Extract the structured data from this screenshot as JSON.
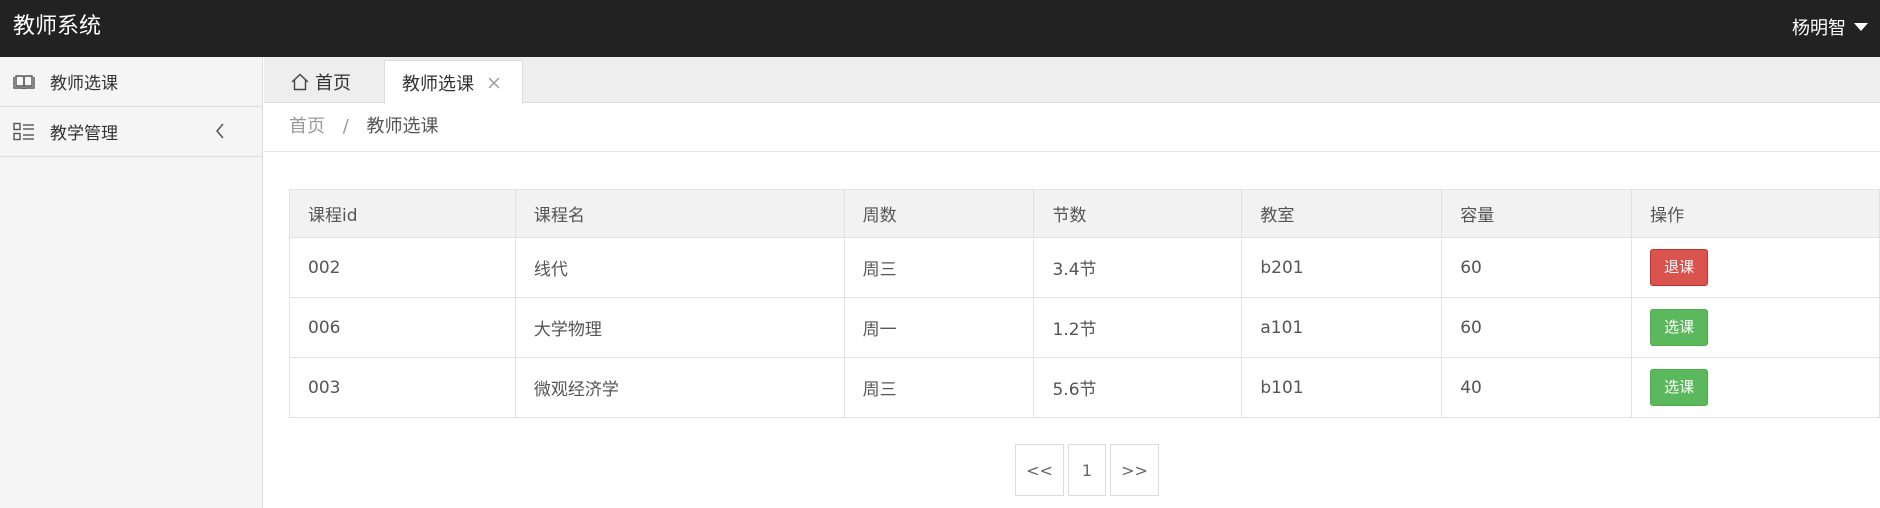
{
  "header": {
    "brand": "教师系统",
    "user": "杨明智"
  },
  "sidebar": {
    "items": [
      {
        "label": "教师选课",
        "icon": "book-icon"
      },
      {
        "label": "教学管理",
        "icon": "list-icon"
      }
    ]
  },
  "tabs": {
    "home": "首页",
    "active": "教师选课"
  },
  "breadcrumb": {
    "home": "首页",
    "separator": "/",
    "current": "教师选课"
  },
  "table": {
    "headers": [
      "课程id",
      "课程名",
      "周数",
      "节数",
      "教室",
      "容量",
      "操作"
    ],
    "rows": [
      {
        "id": "002",
        "name": "线代",
        "week": "周三",
        "section": "3.4节",
        "room": "b201",
        "capacity": "60",
        "action": "退课",
        "action_type": "danger"
      },
      {
        "id": "006",
        "name": "大学物理",
        "week": "周一",
        "section": "1.2节",
        "room": "a101",
        "capacity": "60",
        "action": "选课",
        "action_type": "success"
      },
      {
        "id": "003",
        "name": "微观经济学",
        "week": "周三",
        "section": "5.6节",
        "room": "b101",
        "capacity": "40",
        "action": "选课",
        "action_type": "success"
      }
    ]
  },
  "pagination": {
    "prev": "<<",
    "current": "1",
    "next": ">>"
  },
  "colors": {
    "header_bg": "#222222",
    "danger": "#d9534f",
    "success": "#5cb85c"
  }
}
